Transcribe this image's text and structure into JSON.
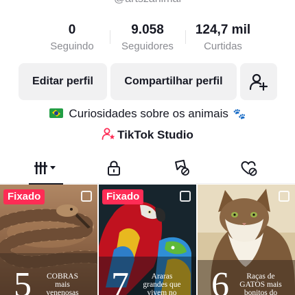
{
  "profile": {
    "handle": "@artszanimal",
    "bio_text": "Curiosidades sobre os animais",
    "studio_label": "TikTok Studio"
  },
  "stats": [
    {
      "value": "0",
      "label": "Seguindo"
    },
    {
      "value": "9.058",
      "label": "Seguidores"
    },
    {
      "value": "124,7 mil",
      "label": "Curtidas"
    }
  ],
  "actions": {
    "edit_label": "Editar perfil",
    "share_label": "Compartilhar perfil",
    "add_friend_icon": "add-user-icon"
  },
  "tabs": [
    {
      "icon": "videos-grid-icon",
      "active": true
    },
    {
      "icon": "lock-icon",
      "active": false
    },
    {
      "icon": "favorites-icon",
      "active": false
    },
    {
      "icon": "liked-icon",
      "active": false
    }
  ],
  "videos": [
    {
      "badge": "Fixado",
      "number": "5",
      "caption": "COBRAS\nmais\nvenenosas"
    },
    {
      "badge": "Fixado",
      "number": "7",
      "caption": "Araras\ngrandes que\nvivem no"
    },
    {
      "badge": "",
      "number": "6",
      "caption": "Raças de\nGATOS mais\nbonitos do"
    }
  ],
  "colors": {
    "accent": "#fe2c55",
    "text": "#161823",
    "muted": "#8a8b91",
    "button_bg": "#f1f1f2"
  }
}
